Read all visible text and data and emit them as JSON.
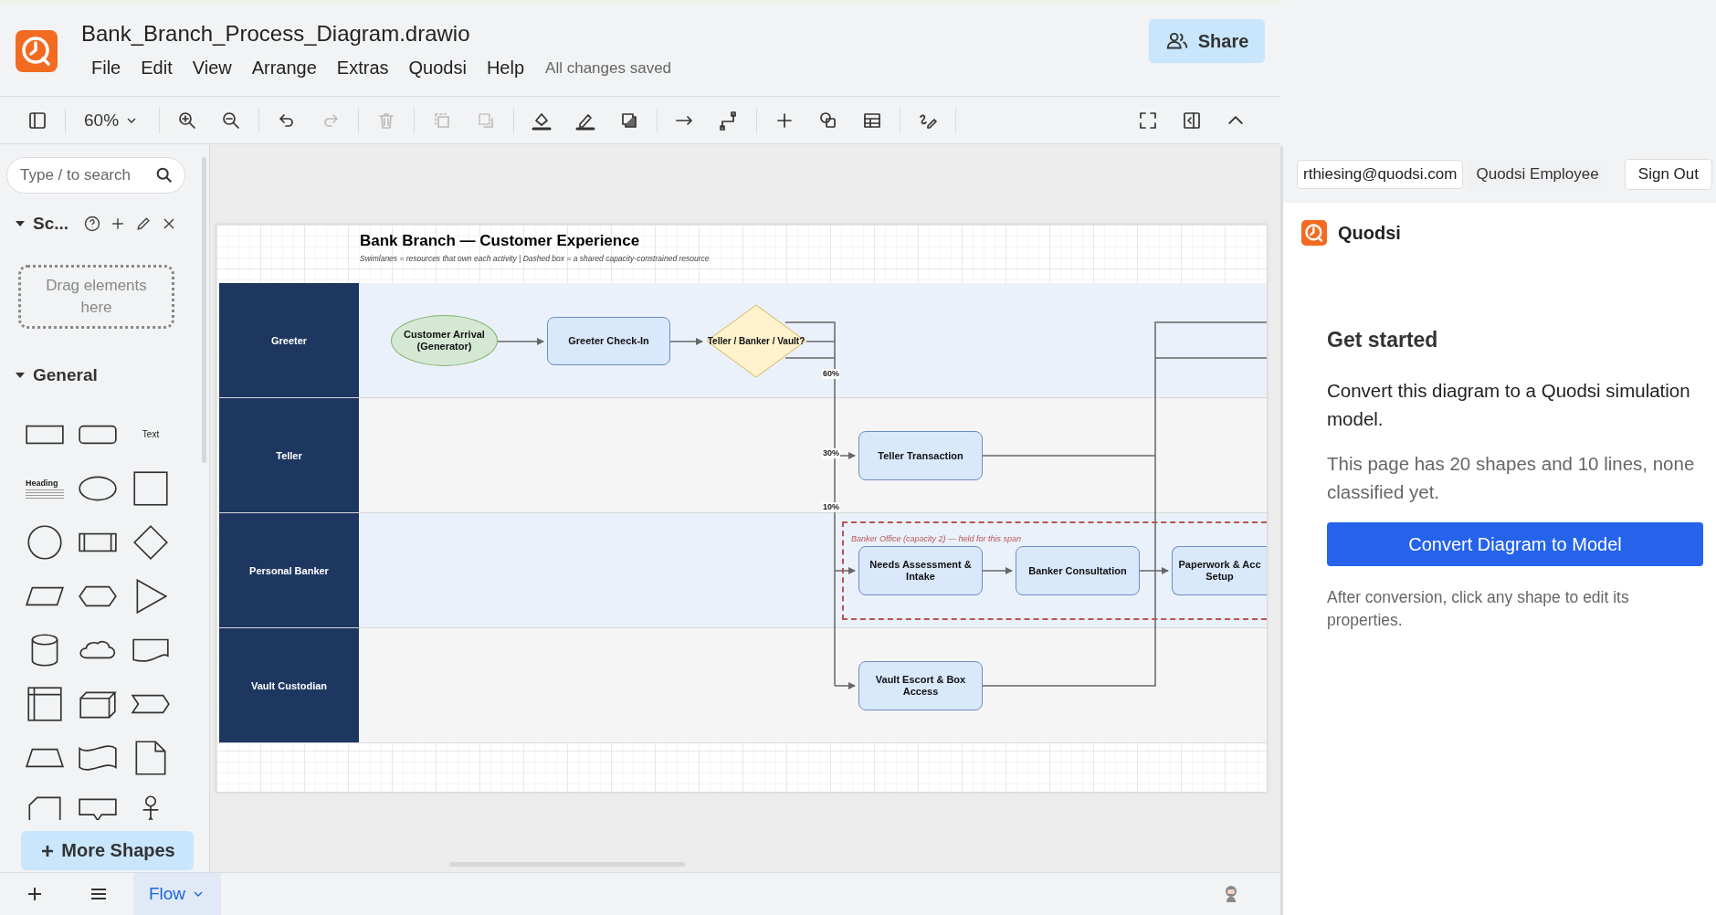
{
  "app": {
    "file_name": "Bank_Branch_Process_Diagram.drawio",
    "save_status": "All changes saved",
    "share_label": "Share"
  },
  "menu": [
    "File",
    "Edit",
    "View",
    "Arrange",
    "Extras",
    "Quodsi",
    "Help"
  ],
  "toolbar": {
    "zoom": "60%",
    "groups": [
      [
        {
          "kind": "sidebar-toggle",
          "disabled": false
        }
      ],
      [
        {
          "kind": "zoom-in",
          "disabled": false
        },
        {
          "kind": "zoom-out",
          "disabled": false
        }
      ],
      [
        {
          "kind": "undo",
          "disabled": false
        },
        {
          "kind": "redo",
          "disabled": true
        }
      ],
      [
        {
          "kind": "delete",
          "disabled": true
        }
      ],
      [
        {
          "kind": "to-front",
          "disabled": true
        },
        {
          "kind": "to-back",
          "disabled": true
        }
      ],
      [
        {
          "kind": "fill",
          "disabled": false
        },
        {
          "kind": "line-color",
          "disabled": false
        },
        {
          "kind": "shadow",
          "disabled": false
        }
      ],
      [
        {
          "kind": "connector",
          "disabled": false
        },
        {
          "kind": "waypoints",
          "disabled": false
        }
      ],
      [
        {
          "kind": "insert",
          "disabled": false
        },
        {
          "kind": "shapes",
          "disabled": false
        },
        {
          "kind": "table",
          "disabled": false
        }
      ],
      [
        {
          "kind": "freehand",
          "disabled": false
        }
      ]
    ],
    "right": [
      {
        "kind": "fullscreen",
        "disabled": false
      },
      {
        "kind": "format-panel",
        "disabled": false
      },
      {
        "kind": "collapse",
        "disabled": false
      }
    ]
  },
  "sidebar": {
    "search_placeholder": "Type / to search",
    "scratchpad": {
      "title": "Sc...",
      "expanded": true,
      "drop_hint": "Drag elements here"
    },
    "general": {
      "title": "General",
      "expanded": true
    },
    "text_shape": "Text",
    "heading_shape": "Heading",
    "more_shapes": "More Shapes"
  },
  "footer": {
    "pages": [
      {
        "label": "Flow",
        "selected": true
      }
    ]
  },
  "diagram": {
    "title": "Bank Branch — Customer Experience",
    "subtitle": "Swimlanes = resources that own each activity | Dashed box = a shared capacity-constrained resource",
    "lanes": [
      {
        "label": "Greeter",
        "color": "#eaf1fb"
      },
      {
        "label": "Teller",
        "color": "#f5f5f5"
      },
      {
        "label": "Personal Banker",
        "color": "#eaf1fb"
      },
      {
        "label": "Vault Custodian",
        "color": "#f5f5f5"
      }
    ],
    "nodes": [
      {
        "label": "Customer Arrival (Generator)",
        "kind": "start"
      },
      {
        "label": "Greeter Check-In",
        "kind": "process"
      },
      {
        "label": "Teller / Banker / Vault?",
        "kind": "decision"
      },
      {
        "label": "Teller Transaction",
        "kind": "process"
      },
      {
        "label": "Needs Assessment & Intake",
        "kind": "process"
      },
      {
        "label": "Banker Consultation",
        "kind": "process"
      },
      {
        "label": "Paperwork & Acc Setup",
        "kind": "process"
      },
      {
        "label": "Vault Escort & Box Access",
        "kind": "process"
      }
    ],
    "branch_labels": [
      "60%",
      "30%",
      "10%"
    ],
    "region_label": "Banker Office (capacity 2) — held for this span"
  },
  "panel": {
    "email": "rthiesing@quodsi.com",
    "role": "Quodsi Employee",
    "sign_out": "Sign Out",
    "brand": "Quodsi",
    "heading": "Get started",
    "intro": "Convert this diagram to a Quodsi simulation model.",
    "status": "This page has 20 shapes and 10 lines, none classified yet.",
    "convert_button": "Convert Diagram to Model",
    "hint": "After conversion, click any shape to edit its properties."
  }
}
